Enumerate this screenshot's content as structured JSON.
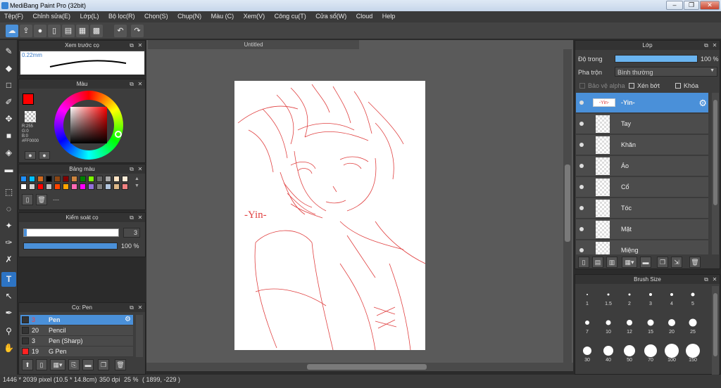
{
  "window": {
    "title": "MediBang Paint Pro (32bit)",
    "min": "–",
    "max": "❐",
    "close": "✕"
  },
  "menu": [
    "Tệp(F)",
    "Chỉnh sửa(E)",
    "Lớp(L)",
    "Bộ lọc(R)",
    "Chọn(S)",
    "Chụp(N)",
    "Màu (C)",
    "Xem(V)",
    "Công cụ(T)",
    "Cửa sổ(W)",
    "Cloud",
    "Help"
  ],
  "brush_preview": {
    "title": "Xem trước cọ",
    "size_label": "0.22mm"
  },
  "color_panel": {
    "title": "Màu",
    "r": "R:255",
    "g": "G:0",
    "b": "B:0",
    "hex": "#FF0000",
    "primary": "#ff0000"
  },
  "palette": {
    "title": "Bảng màu",
    "colors": [
      "#1e90ff",
      "#00bfff",
      "#d2691e",
      "#000000",
      "#8b4513",
      "#800000",
      "#cd853f",
      "#008000",
      "#7cfc00",
      "#696969",
      "#a9a9a9",
      "#ffe4c4",
      "#faebd7",
      "#ffffff",
      "#d3d3d3",
      "#ff0000",
      "#c0c0c0",
      "#ff4500",
      "#ffa500",
      "#ff69b4",
      "#ff00ff",
      "#9370db",
      "#808080",
      "#b0c4de",
      "#deb887",
      "#f08080"
    ],
    "more": "---"
  },
  "brush_control": {
    "title": "Kiểm soát cọ",
    "size": "3",
    "opacity": "100 %"
  },
  "brushes": {
    "title": "Cọ: Pen",
    "items": [
      {
        "size": "3",
        "name": "Pen",
        "color": "#333333"
      },
      {
        "size": "20",
        "name": "Pencil",
        "color": "#333333"
      },
      {
        "size": "3",
        "name": "Pen (Sharp)",
        "color": "#333333"
      },
      {
        "size": "19",
        "name": "G Pen",
        "color": "#ff2222"
      }
    ]
  },
  "document": {
    "tab": "Untitled",
    "signature": "-Yin-"
  },
  "layers": {
    "title": "Lớp",
    "opacity_label": "Độ trong",
    "opacity_value": "100 %",
    "opacity_fraction": 1.0,
    "blend_label": "Pha trộn",
    "blend_value": "Bình thường",
    "protect_alpha": "Bảo vệ alpha",
    "clipping": "Xén bớt",
    "lock": "Khóa",
    "items": [
      "-Yin-",
      "Tay",
      "Khăn",
      "Áo",
      "Cổ",
      "Tóc",
      "Mặt",
      "Miệng"
    ]
  },
  "brush_size": {
    "title": "Brush Size",
    "sizes": [
      "1",
      "1.5",
      "2",
      "3",
      "4",
      "5",
      "7",
      "10",
      "12",
      "15",
      "20",
      "25",
      "30",
      "40",
      "50",
      "70",
      "100",
      "150"
    ]
  },
  "status": {
    "dims": "1446 * 2039 pixel",
    "cm": "(10.5 * 14.8cm)",
    "dpi": "350 dpi",
    "zoom": "25 %",
    "coords": "( 1899, -229 )"
  }
}
